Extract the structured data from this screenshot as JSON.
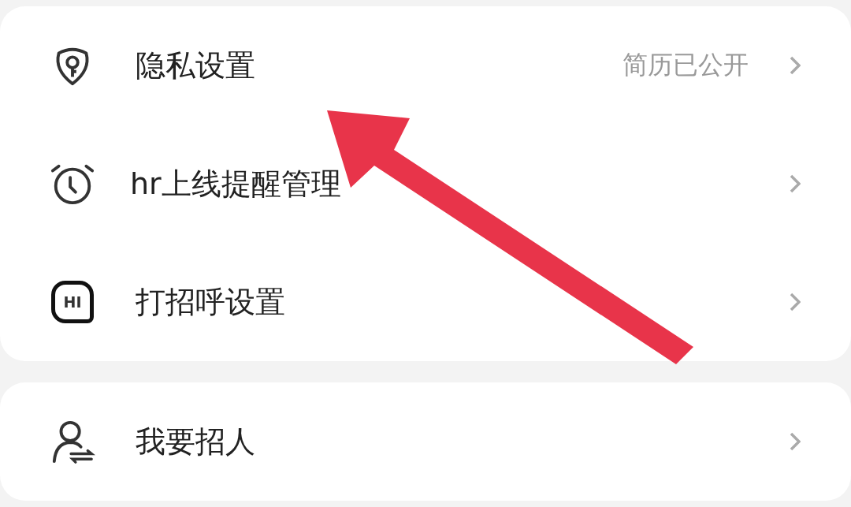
{
  "cards": [
    {
      "items": [
        {
          "kind": "shield",
          "label": "隐私设置",
          "value": "简历已公开"
        },
        {
          "kind": "alarm",
          "label": "hr上线提醒管理"
        },
        {
          "kind": "hi",
          "label": "打招呼设置",
          "icon_text": "HI"
        }
      ]
    },
    {
      "items": [
        {
          "kind": "person",
          "label": "我要招人"
        }
      ]
    }
  ]
}
